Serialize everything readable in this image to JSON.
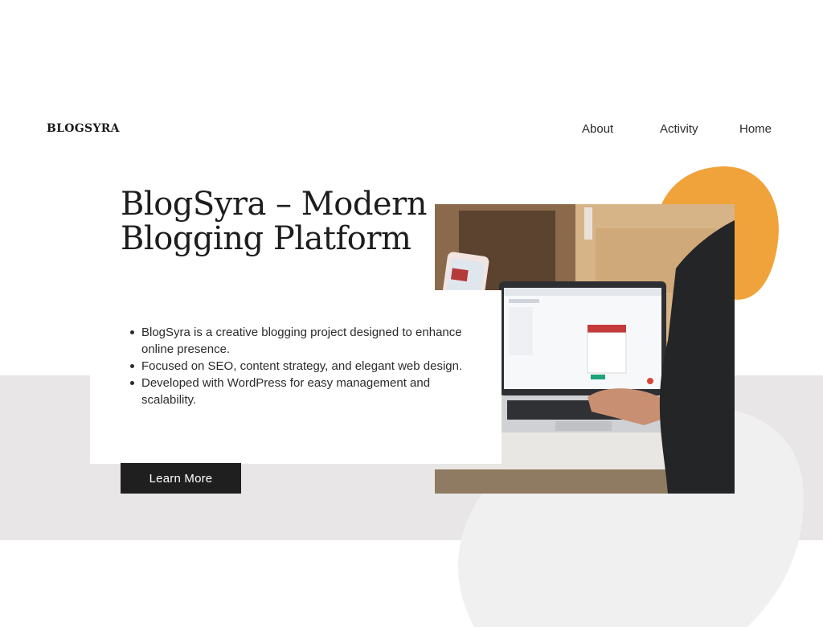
{
  "header": {
    "brand": "BLOGSYRA",
    "nav": [
      {
        "label": "About"
      },
      {
        "label": "Activity"
      },
      {
        "label": "Home"
      }
    ]
  },
  "hero": {
    "title_line1": "BlogSyra – Modern",
    "title_line2": "Blogging Platform",
    "bullets": [
      "BlogSyra is a creative blogging project designed to enhance online presence.",
      "Focused on SEO, content strategy, and elegant web design.",
      "Developed with WordPress for easy management and scalability."
    ],
    "cta_label": "Learn More"
  },
  "colors": {
    "accent_orange": "#f0a33a",
    "band_gray": "#e8e6e7",
    "button_dark": "#1f1f1f"
  }
}
